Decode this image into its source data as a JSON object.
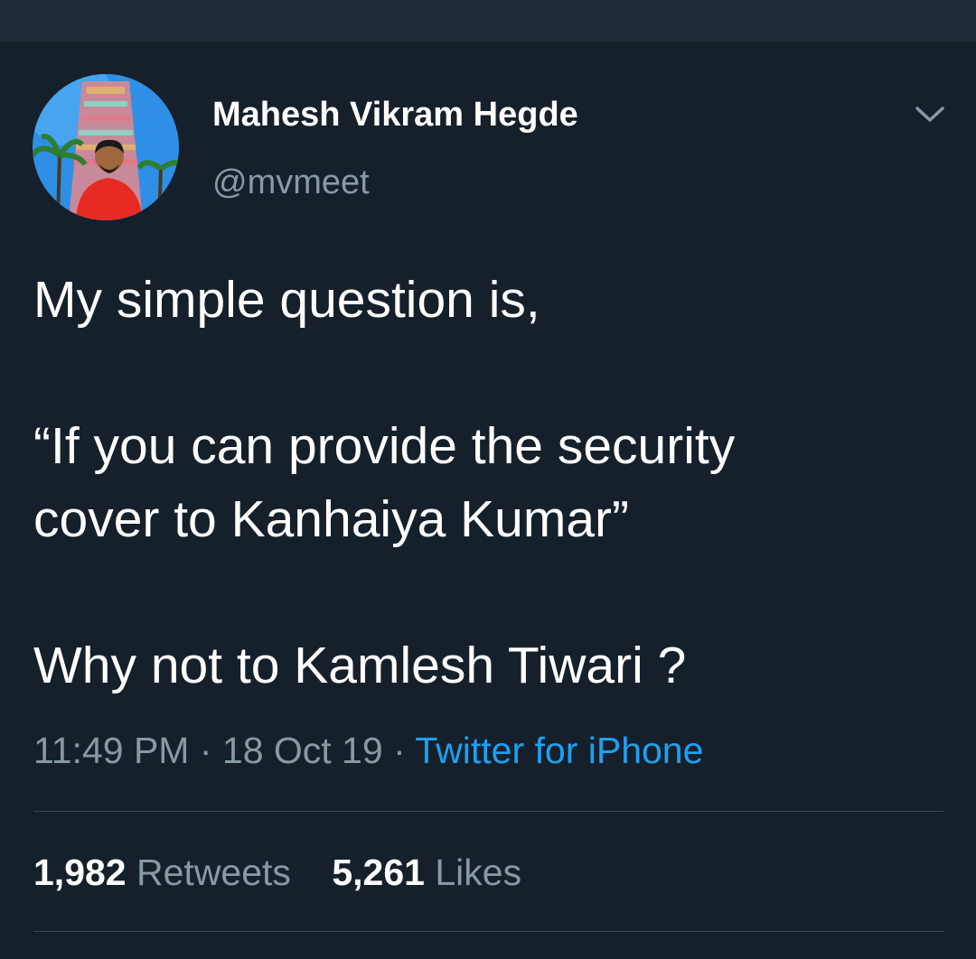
{
  "colors": {
    "background": "#15202b",
    "top_bar": "#1e2a37",
    "primary_text": "#ffffff",
    "secondary_text": "#8899a6",
    "link": "#1da1f2",
    "divider": "#38444d"
  },
  "author": {
    "display_name": "Mahesh Vikram Hegde",
    "handle": "@mvmeet",
    "avatar_icon": "profile-photo"
  },
  "menu_icon": "chevron-down-icon",
  "tweet": {
    "lines": [
      "My simple question is,",
      "“If you can provide the security",
      "cover to Kanhaiya Kumar”",
      "Why not to Kamlesh Tiwari ?"
    ]
  },
  "meta": {
    "time": "11:49 PM",
    "separator": " · ",
    "date": "18 Oct 19",
    "source": "Twitter for iPhone"
  },
  "stats": {
    "retweets_count": "1,982",
    "retweets_label": "Retweets",
    "likes_count": "5,261",
    "likes_label": "Likes"
  }
}
